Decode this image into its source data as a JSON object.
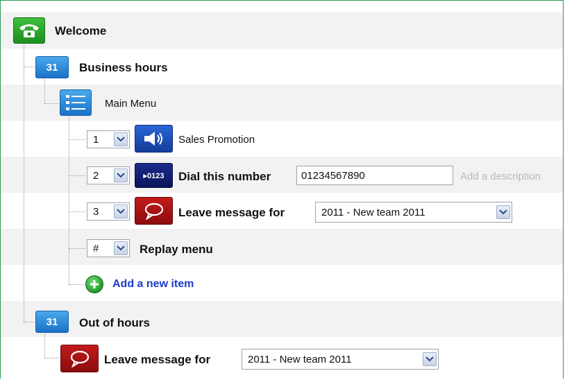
{
  "tree": {
    "welcome": {
      "label": "Welcome",
      "icon": "phone-icon"
    },
    "business_hours": {
      "label": "Business hours",
      "icon_text": "31"
    },
    "main_menu": {
      "label": "Main Menu"
    },
    "items": [
      {
        "key": "1",
        "label": "Sales Promotion",
        "icon": "speaker-icon"
      },
      {
        "key": "2",
        "label": "Dial this number",
        "icon_text": "▸0123",
        "number": "01234567890",
        "description_placeholder": "Add a description"
      },
      {
        "key": "3",
        "label": "Leave message for",
        "icon": "speech-bubble-icon",
        "target": "2011 - New team 2011"
      },
      {
        "key": "#",
        "label": "Replay menu"
      }
    ],
    "add_item": {
      "label": "Add a new item"
    },
    "out_of_hours": {
      "label": "Out of hours",
      "icon_text": "31"
    },
    "out_of_hours_action": {
      "label": "Leave message for",
      "target": "2011 - New team 2011"
    }
  },
  "colors": {
    "accent_link": "#1a3cc8",
    "frame_border": "#2f9a5a",
    "band": "#f2f2f2"
  }
}
